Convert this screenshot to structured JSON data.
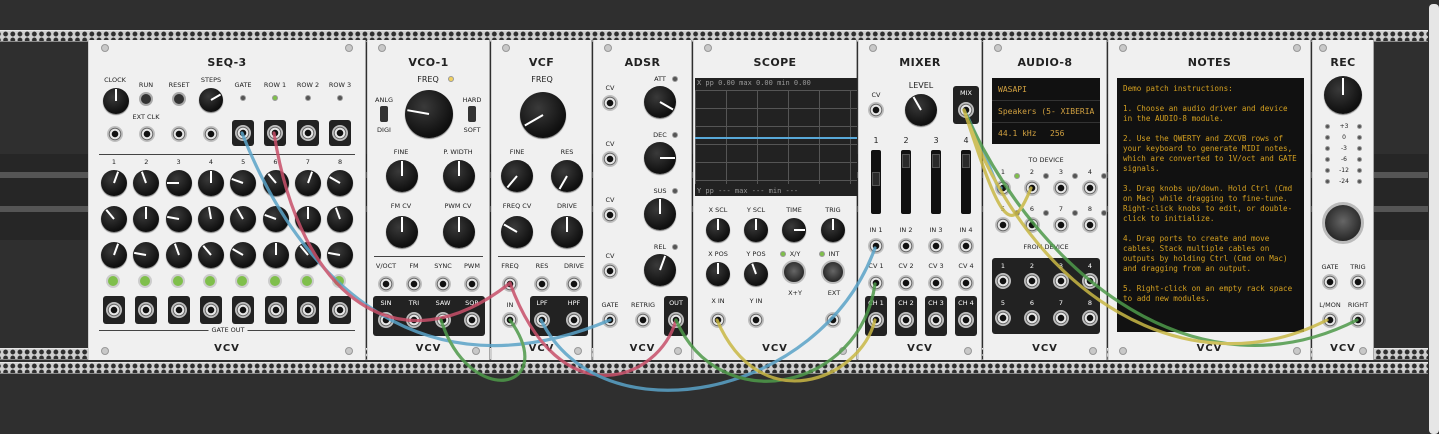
{
  "modules": {
    "seq3": {
      "title": "SEQ-3",
      "logo": "VCV",
      "clock": "CLOCK",
      "run": "RUN",
      "reset": "RESET",
      "steps": "STEPS",
      "ext_clk": "EXT CLK",
      "gate": "GATE",
      "row1": "ROW 1",
      "row2": "ROW 2",
      "row3": "ROW 3",
      "step_labels": [
        "1",
        "2",
        "3",
        "4",
        "5",
        "6",
        "7",
        "8"
      ],
      "gate_out": "GATE OUT"
    },
    "vco1": {
      "title": "VCO-1",
      "logo": "VCV",
      "freq": "FREQ",
      "anlg": "ANLG",
      "digi": "DIGI",
      "hard": "HARD",
      "soft": "SOFT",
      "fine": "FINE",
      "pwidth": "P. WIDTH",
      "fmcv": "FM CV",
      "pwmcv": "PWM CV",
      "voct": "V/OCT",
      "fm": "FM",
      "sync": "SYNC",
      "pwm": "PWM",
      "sin": "SIN",
      "tri": "TRI",
      "saw": "SAW",
      "sqr": "SQR"
    },
    "vcf": {
      "title": "VCF",
      "logo": "VCV",
      "freq": "FREQ",
      "fine": "FINE",
      "res": "RES",
      "freqcv": "FREQ CV",
      "drive": "DRIVE",
      "freq_in": "FREQ",
      "res_in": "RES",
      "drive_in": "DRIVE",
      "in": "IN",
      "lpf": "LPF",
      "hpf": "HPF"
    },
    "adsr": {
      "title": "ADSR",
      "logo": "VCV",
      "att": "ATT",
      "dec": "DEC",
      "sus": "SUS",
      "rel": "REL",
      "cv": "CV",
      "gate": "GATE",
      "retrig": "RETRIG",
      "out": "OUT"
    },
    "scope": {
      "title": "SCOPE",
      "logo": "VCV",
      "top_readout": "X  pp  0.00  max  0.00  min  0.00",
      "bot_readout": "Y  pp  ---  max  ---  min  ---",
      "xscl": "X SCL",
      "yscl": "Y SCL",
      "time": "TIME",
      "trig": "TRIG",
      "xpos": "X POS",
      "ypos": "Y POS",
      "xy": "X/Y",
      "xplusy": "X+Y",
      "int": "INT",
      "ext": "EXT",
      "xin": "X IN",
      "yin": "Y IN"
    },
    "mixer": {
      "title": "MIXER",
      "logo": "VCV",
      "cv": "CV",
      "level": "LEVEL",
      "mix": "MIX",
      "channels": [
        "1",
        "2",
        "3",
        "4"
      ],
      "ins": [
        "IN 1",
        "IN 2",
        "IN 3",
        "IN 4"
      ],
      "cvs": [
        "CV 1",
        "CV 2",
        "CV 3",
        "CV 4"
      ],
      "chs": [
        "CH 1",
        "CH 2",
        "CH 3",
        "CH 4"
      ]
    },
    "audio8": {
      "title": "AUDIO-8",
      "logo": "VCV",
      "driver": "WASAPI",
      "device": "Speakers (5- XIBERIA",
      "rate": "44.1 kHz",
      "block": "256",
      "to_device": "TO DEVICE",
      "from_device": "FROM DEVICE",
      "ports": [
        "1",
        "2",
        "3",
        "4",
        "5",
        "6",
        "7",
        "8"
      ]
    },
    "notes": {
      "title": "NOTES",
      "logo": "VCV",
      "text": "Demo patch instructions:\n\n1. Choose an audio driver and device in the AUDIO-8 module.\n\n2. Use the QWERTY and ZXCVB rows of your keyboard to generate MIDI notes, which are converted to 1V/oct and GATE signals.\n\n3. Drag knobs up/down. Hold Ctrl (Cmd on Mac) while dragging to fine-tune. Right-click knobs to edit, or double-click to initialize.\n\n4. Drag ports to create and move cables. Stack multiple cables on outputs by holding Ctrl (Cmd on Mac) and dragging from an output.\n\n5. Right-click on an empty rack space to add new modules."
    },
    "rec": {
      "title": "REC",
      "logo": "VCV",
      "meter": [
        "+3",
        "0",
        "-3",
        "-6",
        "-12",
        "-24"
      ],
      "gate": "GATE",
      "trig": "TRIG",
      "lmon": "L/MON",
      "right": "RIGHT"
    }
  },
  "colors": {
    "panel": "#f0f0f0",
    "rack": "#2f2f2f",
    "cable_blue": "#5aa3c8",
    "cable_red": "#c8506a",
    "cable_green": "#4e9a4a",
    "cable_yellow": "#c9b845",
    "scope_trace": "#58a8d8",
    "display_text": "#d0a040"
  }
}
